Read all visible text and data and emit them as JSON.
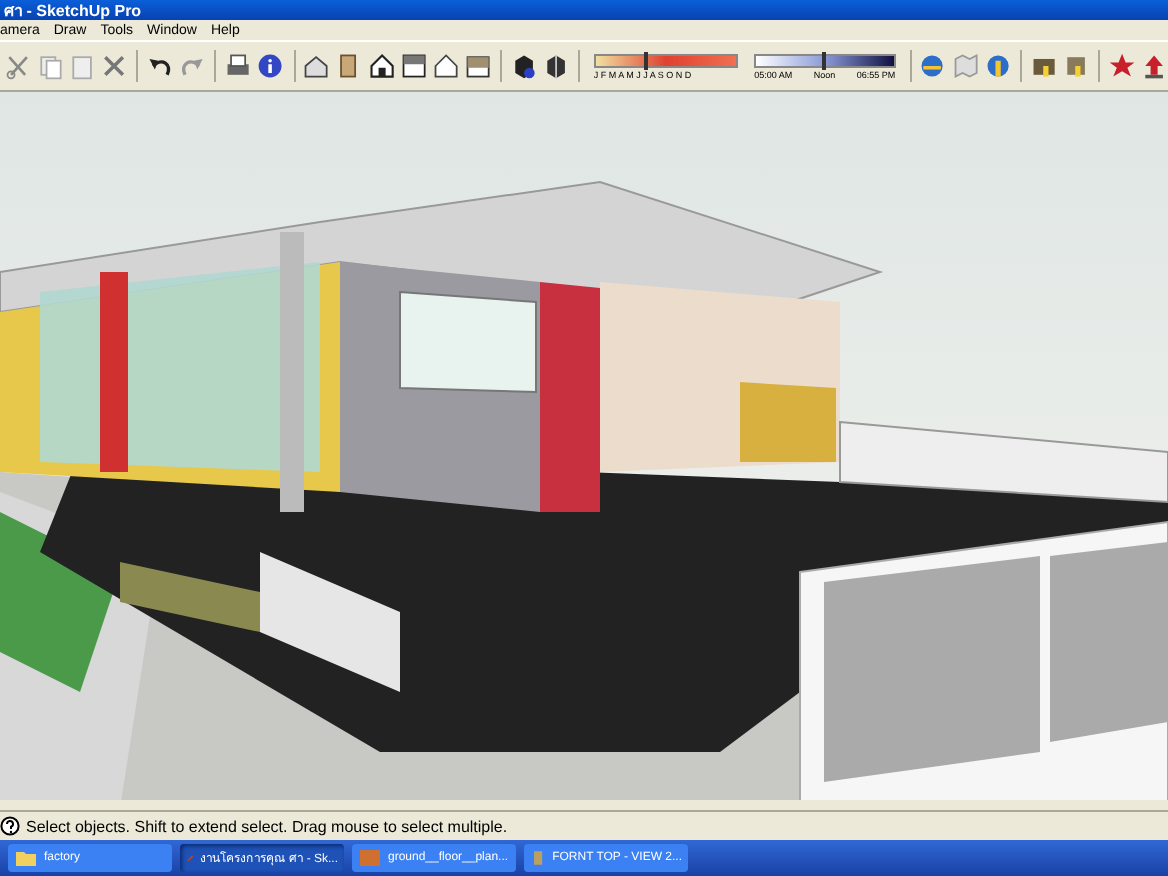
{
  "window": {
    "title": "ศา - SketchUp Pro"
  },
  "menu": [
    "amera",
    "Draw",
    "Tools",
    "Window",
    "Help"
  ],
  "shadow_settings": {
    "months": "J F M A M J J A S O N D",
    "month_slider": {
      "level": 0.35
    },
    "time_start": "05:00 AM",
    "time_mid": "Noon",
    "time_end": "06:55 PM",
    "time_slider": {
      "level": 0.48
    }
  },
  "status_bar": {
    "text": "Select objects. Shift to extend select. Drag mouse to select multiple."
  },
  "taskbar": [
    {
      "label": "factory",
      "kind": "folder",
      "selected": false
    },
    {
      "label": "งานโครงการคุณ ศา - Sk...",
      "kind": "sketchup",
      "selected": true
    },
    {
      "label": "ground__floor__plan...",
      "kind": "image",
      "selected": false
    },
    {
      "label": "FORNT TOP - VIEW 2...",
      "kind": "document",
      "selected": false
    }
  ]
}
